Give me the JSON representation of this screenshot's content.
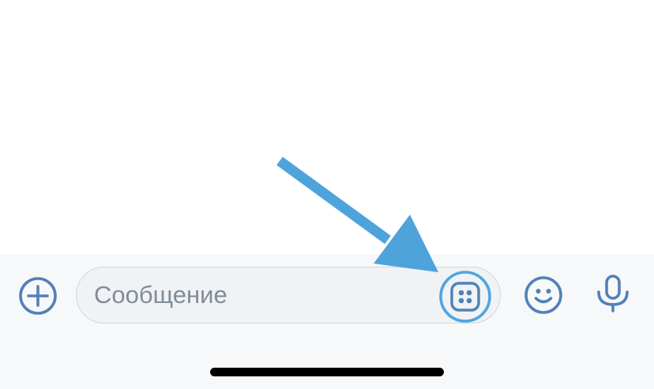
{
  "composer": {
    "message_placeholder": "Сообщение",
    "message_value": ""
  },
  "icons": {
    "add": "plus-circle-icon",
    "apps": "apps-grid-icon",
    "emoji": "emoji-smile-icon",
    "microphone": "microphone-icon"
  },
  "colors": {
    "accent": "#5181b8",
    "apps_highlight": "#4da6dd",
    "annotation_arrow": "#4ea3db",
    "bar_background": "#f7f8fa",
    "field_background": "#f0f2f5",
    "placeholder_text": "#818c99"
  }
}
